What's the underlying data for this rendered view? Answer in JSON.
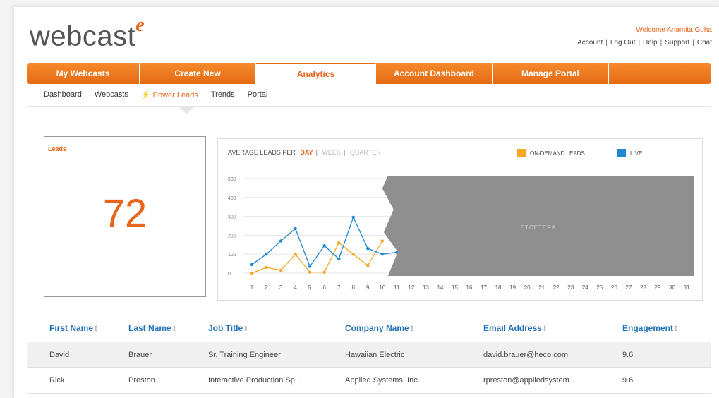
{
  "app": {
    "logo_text": "webcast",
    "logo_super": "e",
    "welcome": "Welcome Anamita Guha",
    "top_links": [
      "Account",
      "Log Out",
      "Help",
      "Support",
      "Chat"
    ]
  },
  "nav": {
    "tabs": [
      {
        "label": "My Webcasts",
        "active": false
      },
      {
        "label": "Create New",
        "active": false
      },
      {
        "label": "Analytics",
        "active": true
      },
      {
        "label": "Account Dashboard",
        "active": false
      },
      {
        "label": "Manage Portal",
        "active": false
      },
      {
        "label": "",
        "active": false
      }
    ]
  },
  "subnav": {
    "items": [
      {
        "label": "Dashboard",
        "active": false
      },
      {
        "label": "Webcasts",
        "active": false
      },
      {
        "label": "Power Leads",
        "active": true
      },
      {
        "label": "Trends",
        "active": false
      },
      {
        "label": "Portal",
        "active": false
      }
    ]
  },
  "leads": {
    "label": "Leads",
    "count": "72"
  },
  "chart_header": {
    "prefix": "AVERAGE LEADS PER",
    "periods": [
      {
        "label": "DAY",
        "active": true
      },
      {
        "label": "WEEK",
        "active": false
      },
      {
        "label": "QUARTER",
        "active": false
      }
    ],
    "legend": [
      {
        "label": "ON-DEMAND LEADS",
        "color": "#f5a623"
      },
      {
        "label": "LIVE",
        "color": "#1e88d2"
      }
    ],
    "placeholder_text": "ETCETERA"
  },
  "chart_data": {
    "type": "line",
    "x": [
      1,
      2,
      3,
      4,
      5,
      6,
      7,
      8,
      9,
      10,
      11,
      12,
      13,
      14,
      15,
      16,
      17,
      18,
      19,
      20,
      21,
      22,
      23,
      24,
      25,
      26,
      27,
      28,
      29,
      30,
      31
    ],
    "ylim": [
      0,
      500
    ],
    "yticks": [
      "500",
      "400",
      "300",
      "200",
      "100",
      "0"
    ],
    "series": [
      {
        "name": "ON-DEMAND LEADS",
        "color": "#f5a623",
        "x": [
          1,
          2,
          3,
          4,
          5,
          6,
          7,
          8,
          9,
          10
        ],
        "values": [
          0,
          30,
          15,
          100,
          5,
          5,
          160,
          100,
          40,
          170
        ]
      },
      {
        "name": "LIVE",
        "color": "#1e88d2",
        "x": [
          1,
          2,
          3,
          4,
          5,
          6,
          7,
          8,
          9,
          10,
          11
        ],
        "values": [
          45,
          100,
          170,
          235,
          35,
          145,
          75,
          295,
          130,
          100,
          110
        ]
      }
    ]
  },
  "table": {
    "columns": [
      "First Name",
      "Last Name",
      "Job Title",
      "Company Name",
      "Email Address",
      "Engagement"
    ],
    "sort_glyph": "⇕",
    "rows": [
      [
        "David",
        "Brauer",
        "Sr. Training Engineer",
        "Hawaiian Electric",
        "david.brauer@heco.com",
        "9.6"
      ],
      [
        "Rick",
        "Preston",
        "Interactive Production Sp...",
        "Applied Systems, Inc.",
        "rpreston@appliedsystem...",
        "9.6"
      ]
    ]
  }
}
